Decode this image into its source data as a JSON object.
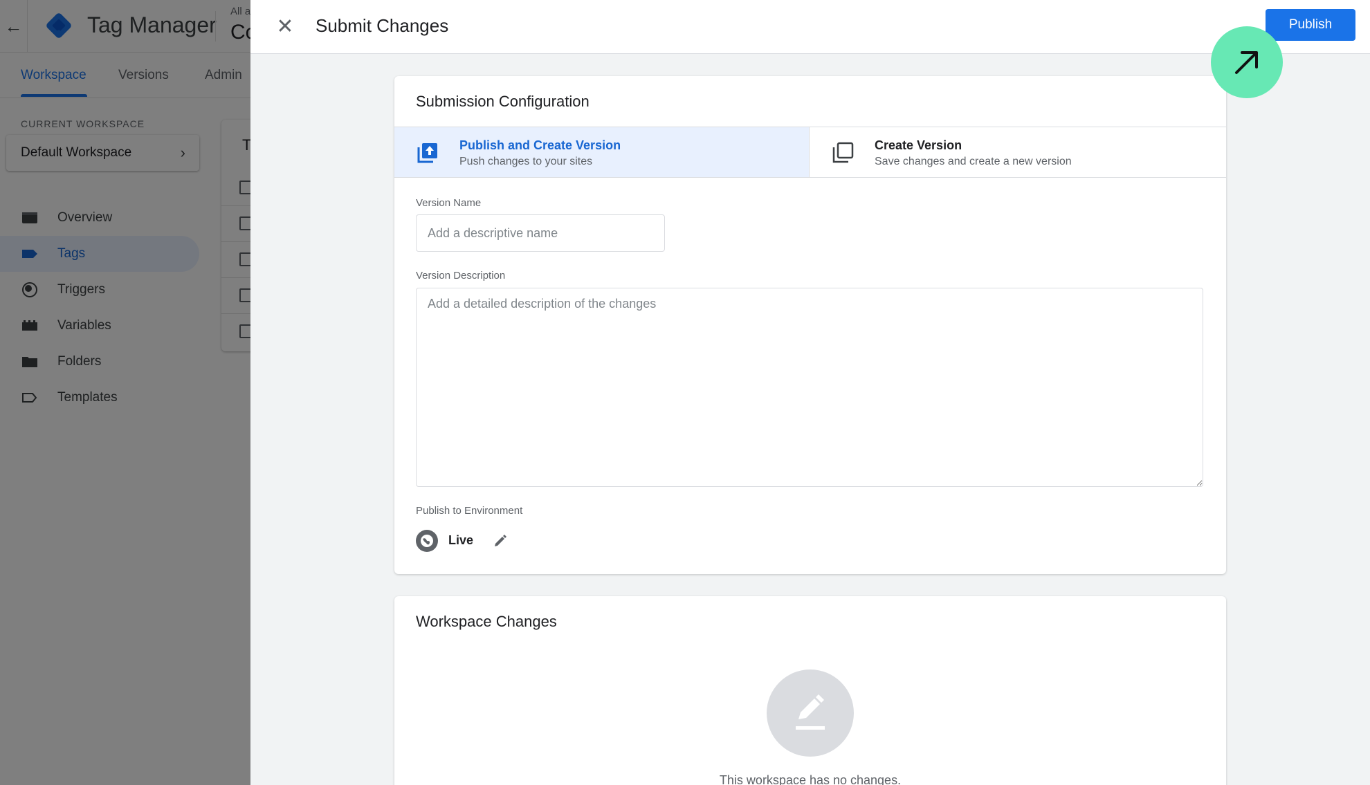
{
  "topbar": {
    "back_icon": "arrow-back-icon",
    "app_title": "Tag Manager",
    "account_label": "All a",
    "account_name": "Co"
  },
  "nav_tabs": [
    {
      "label": "Workspace",
      "active": true
    },
    {
      "label": "Versions",
      "active": false
    },
    {
      "label": "Admin",
      "active": false
    }
  ],
  "sidebar": {
    "current_workspace_label": "CURRENT WORKSPACE",
    "workspace_name": "Default Workspace",
    "items": [
      {
        "label": "Overview",
        "icon": "overview-icon",
        "active": false
      },
      {
        "label": "Tags",
        "icon": "tag-icon",
        "active": true
      },
      {
        "label": "Triggers",
        "icon": "trigger-icon",
        "active": false
      },
      {
        "label": "Variables",
        "icon": "variables-icon",
        "active": false
      },
      {
        "label": "Folders",
        "icon": "folder-icon",
        "active": false
      },
      {
        "label": "Templates",
        "icon": "templates-icon",
        "active": false
      }
    ]
  },
  "content": {
    "card_title_partial": "T"
  },
  "dialog": {
    "close_icon": "close-icon",
    "title": "Submit Changes",
    "publish_label": "Publish",
    "submission": {
      "title": "Submission Configuration",
      "options": [
        {
          "title": "Publish and Create Version",
          "subtitle": "Push changes to your sites",
          "icon": "publish-upload-icon",
          "selected": true
        },
        {
          "title": "Create Version",
          "subtitle": "Save changes and create a new version",
          "icon": "copy-version-icon",
          "selected": false
        }
      ],
      "version_name_label": "Version Name",
      "version_name_placeholder": "Add a descriptive name",
      "version_description_label": "Version Description",
      "version_description_placeholder": "Add a detailed description of the changes",
      "environment_label": "Publish to Environment",
      "environment_name": "Live"
    },
    "workspace_changes": {
      "title": "Workspace Changes",
      "empty_text": "This workspace has no changes."
    }
  },
  "colors": {
    "accent": "#1a73e8",
    "click_hint": "#67e8b4"
  }
}
